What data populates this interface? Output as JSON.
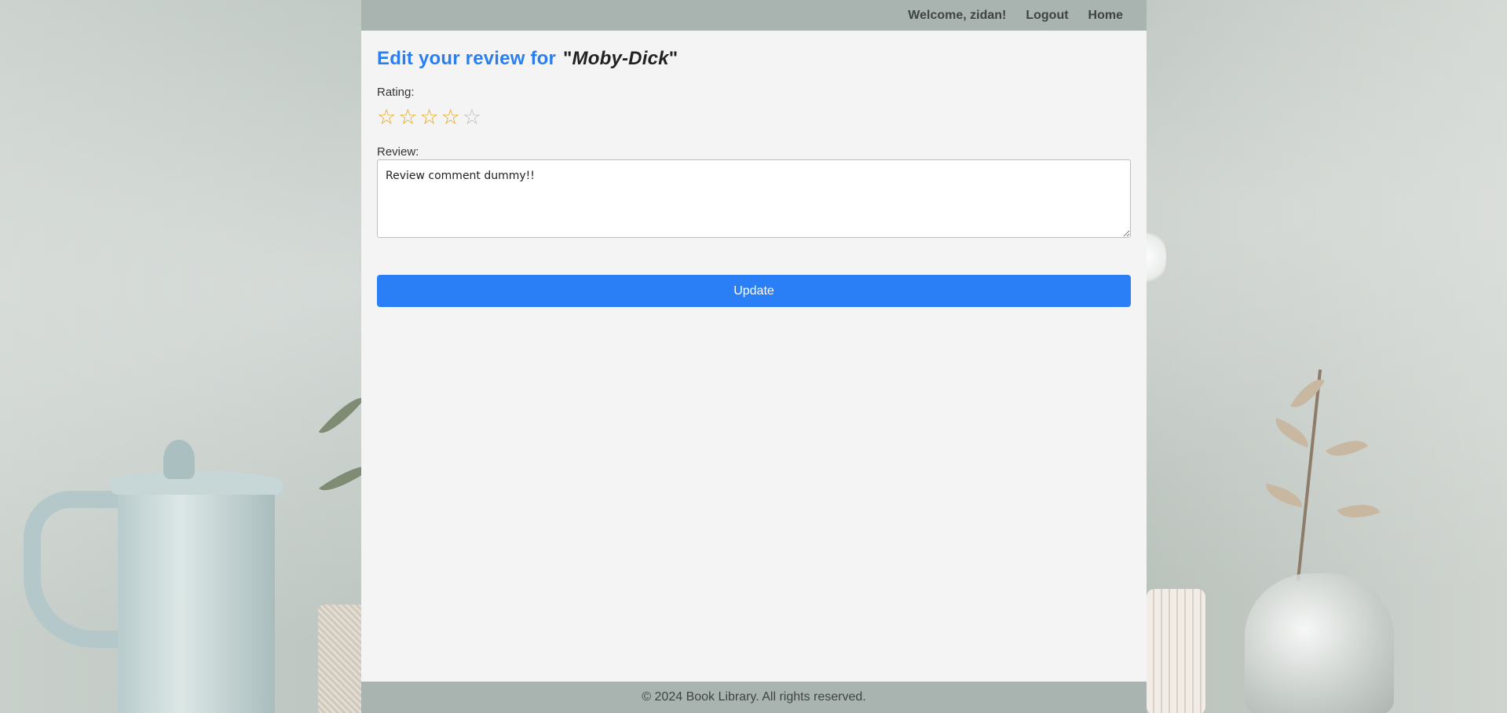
{
  "header": {
    "welcome_text": "Welcome, zidan!",
    "logout_label": "Logout",
    "home_label": "Home"
  },
  "page": {
    "title_prefix": "Edit your review for",
    "book_title": "Moby-Dick",
    "quote_open": "\"",
    "quote_close": "\""
  },
  "form": {
    "rating_label": "Rating:",
    "rating_value": 4,
    "rating_max": 5,
    "star_glyph": "☆",
    "review_label": "Review:",
    "review_value": "Review comment dummy!!",
    "update_label": "Update"
  },
  "footer": {
    "text": "© 2024 Book Library. All rights reserved."
  },
  "colors": {
    "accent": "#2a7ff6",
    "star_active": "#e6a628",
    "star_inactive": "#bdbdbd",
    "bar": "#a9b4b1"
  }
}
